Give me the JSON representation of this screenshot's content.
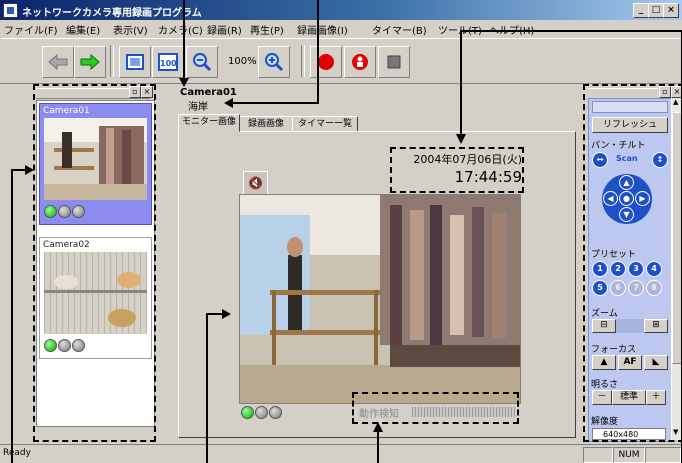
{
  "window": {
    "title": "ネットワークカメラ専用録画プログラム",
    "controls": [
      "_",
      "□",
      "×"
    ]
  },
  "menu": [
    "ファイル(F)",
    "編集(E)",
    "表示(V)",
    "カメラ(C)",
    "録画(R)",
    "再生(P)",
    "録画画像(I)",
    "タイマー(B)",
    "ツール(T)",
    "ヘルプ(H)"
  ],
  "toolbar": {
    "full_label": "100",
    "zoom_level": "100%"
  },
  "camera_list": {
    "items": [
      {
        "label": "Camera01",
        "selected": true
      },
      {
        "label": "Camera02",
        "selected": false
      }
    ]
  },
  "main": {
    "camera_name": "Camera01",
    "location": "海岸",
    "tabs": [
      "モニター画像",
      "録画画像",
      "タイマー一覧"
    ],
    "date": "2004年07月06日(火)",
    "time": "17:44:59",
    "motion_label": "動作検知"
  },
  "control_panel": {
    "refresh": "リフレッシュ",
    "pan_tilt": "パン・チルト",
    "scan": "Scan",
    "preset": "プリセット",
    "presets": [
      "1",
      "2",
      "3",
      "4",
      "5",
      "6",
      "7",
      "8"
    ],
    "zoom": "ズーム",
    "focus": "フォーカス",
    "af": "AF",
    "brightness": "明るさ",
    "bright_minus": "－",
    "bright_std": "標準",
    "bright_plus": "＋",
    "resolution": "解像度",
    "resolution_value": "640x480"
  },
  "status": {
    "text": "Ready",
    "num": "NUM"
  },
  "colors": {
    "title_bar": "#0a246a",
    "selected_camera": "#8c8cf0",
    "ptz_blue": "#1e50c8",
    "record_red": "#e00000"
  }
}
